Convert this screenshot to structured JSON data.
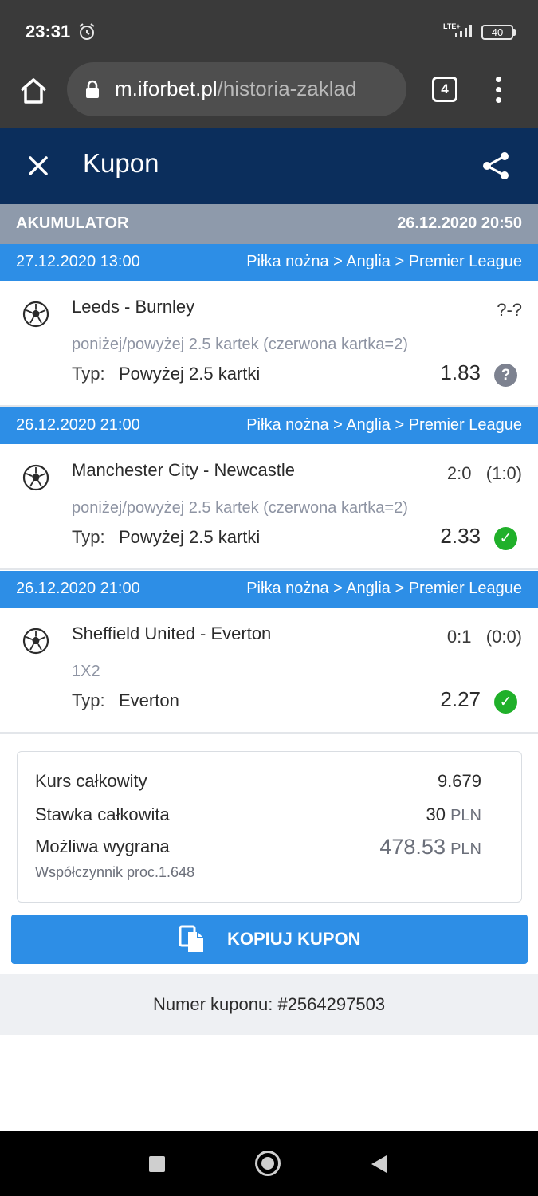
{
  "status_bar": {
    "time": "23:31",
    "network": "LTE+",
    "battery": "40"
  },
  "browser": {
    "url_host": "m.iforbet.pl",
    "url_path": "/historia-zaklad",
    "tab_count": "4"
  },
  "header": {
    "title": "Kupon"
  },
  "coupon": {
    "type": "AKUMULATOR",
    "created": "26.12.2020 20:50"
  },
  "events": [
    {
      "datetime": "27.12.2020 13:00",
      "category": "Piłka nożna > Anglia > Premier League",
      "match": "Leeds - Burnley",
      "score": "?-?",
      "market": "poniżej/powyżej 2.5 kartek (czerwona kartka=2)",
      "typ_label": "Typ:",
      "typ_value": "Powyżej 2.5 kartki",
      "odds": "1.83",
      "status": "pending",
      "status_glyph": "?"
    },
    {
      "datetime": "26.12.2020 21:00",
      "category": "Piłka nożna > Anglia > Premier League",
      "match": "Manchester City - Newcastle",
      "score": "2:0   (1:0)",
      "market": "poniżej/powyżej 2.5 kartek (czerwona kartka=2)",
      "typ_label": "Typ:",
      "typ_value": "Powyżej 2.5 kartki",
      "odds": "2.33",
      "status": "won",
      "status_glyph": "✓"
    },
    {
      "datetime": "26.12.2020 21:00",
      "category": "Piłka nożna > Anglia > Premier League",
      "match": "Sheffield United - Everton",
      "score": "0:1   (0:0)",
      "market": "1X2",
      "typ_label": "Typ:",
      "typ_value": "Everton",
      "odds": "2.27",
      "status": "won",
      "status_glyph": "✓"
    }
  ],
  "summary": {
    "total_odds_label": "Kurs całkowity",
    "total_odds": "9.679",
    "stake_label": "Stawka całkowita",
    "stake": "30",
    "stake_currency": "PLN",
    "win_label": "Możliwa wygrana",
    "win": "478.53",
    "win_currency": "PLN",
    "factor_label": "Współczynnik proc.1.648"
  },
  "copy_button": {
    "label": "KOPIUJ KUPON"
  },
  "coupon_number": {
    "text": "Numer kuponu: #2564297503"
  },
  "colors": {
    "header": "#0b2e5c",
    "accent": "#2d8ee6",
    "won": "#20b02a",
    "pending": "#7d8290",
    "typebar": "#8e9aab"
  }
}
